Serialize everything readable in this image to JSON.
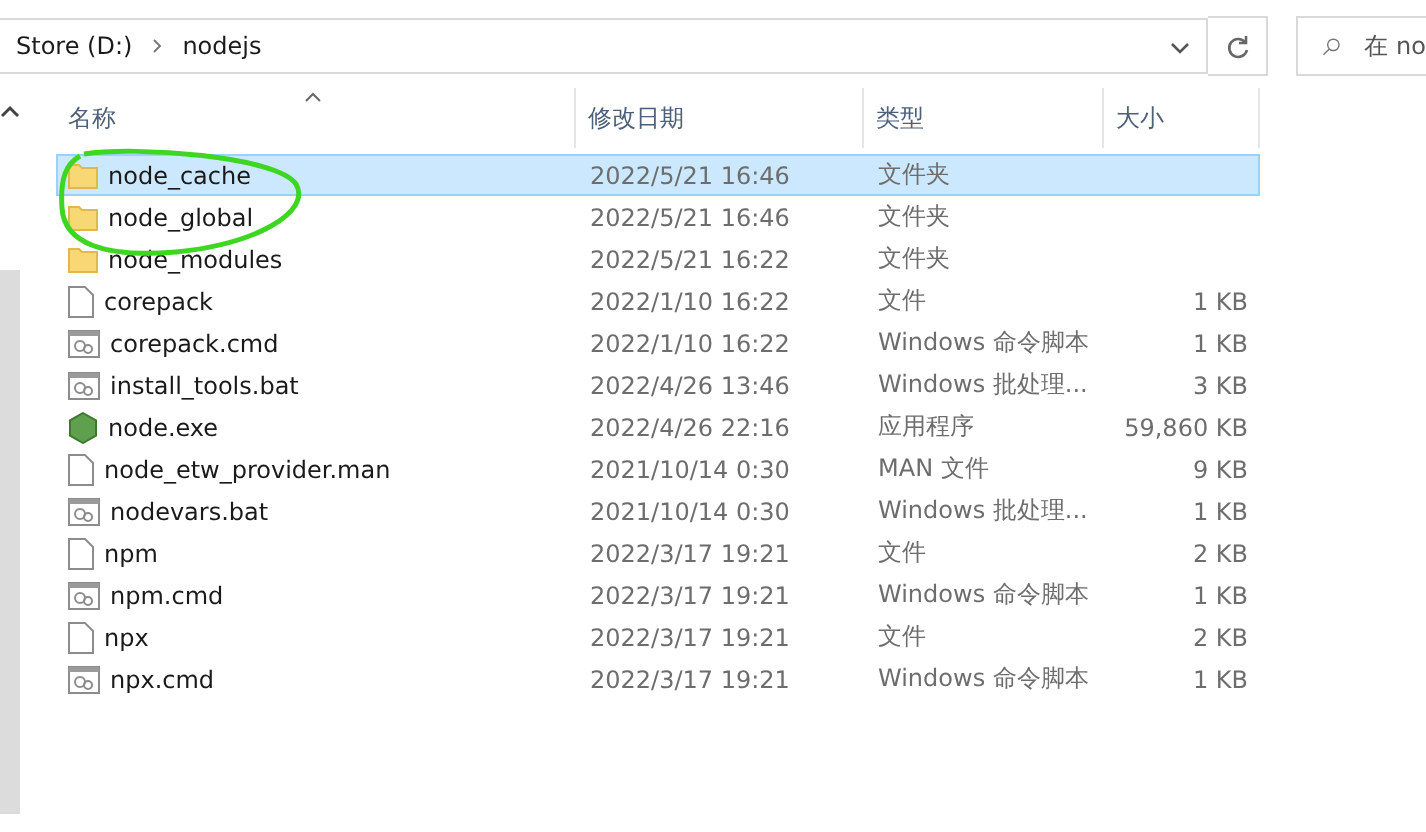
{
  "address_bar": {
    "path": [
      "Store (D:)",
      "nodejs"
    ]
  },
  "search": {
    "placeholder": "在 no"
  },
  "columns": [
    "名称",
    "修改日期",
    "类型",
    "大小"
  ],
  "rows": [
    {
      "kind": "folder",
      "name": "node_cache",
      "date": "2022/5/21 16:46",
      "type": "文件夹",
      "size": "",
      "selected": true
    },
    {
      "kind": "folder",
      "name": "node_global",
      "date": "2022/5/21 16:46",
      "type": "文件夹",
      "size": "",
      "selected": false
    },
    {
      "kind": "folder",
      "name": "node_modules",
      "date": "2022/5/21 16:22",
      "type": "文件夹",
      "size": "",
      "selected": false
    },
    {
      "kind": "file",
      "name": "corepack",
      "date": "2022/1/10 16:22",
      "type": "文件",
      "size": "1 KB",
      "selected": false
    },
    {
      "kind": "script",
      "name": "corepack.cmd",
      "date": "2022/1/10 16:22",
      "type": "Windows 命令脚本",
      "size": "1 KB",
      "selected": false
    },
    {
      "kind": "script",
      "name": "install_tools.bat",
      "date": "2022/4/26 13:46",
      "type": "Windows 批处理...",
      "size": "3 KB",
      "selected": false
    },
    {
      "kind": "exe",
      "name": "node.exe",
      "date": "2022/4/26 22:16",
      "type": "应用程序",
      "size": "59,860 KB",
      "selected": false
    },
    {
      "kind": "file",
      "name": "node_etw_provider.man",
      "date": "2021/10/14 0:30",
      "type": "MAN 文件",
      "size": "9 KB",
      "selected": false
    },
    {
      "kind": "script",
      "name": "nodevars.bat",
      "date": "2021/10/14 0:30",
      "type": "Windows 批处理...",
      "size": "1 KB",
      "selected": false
    },
    {
      "kind": "file",
      "name": "npm",
      "date": "2022/3/17 19:21",
      "type": "文件",
      "size": "2 KB",
      "selected": false
    },
    {
      "kind": "script",
      "name": "npm.cmd",
      "date": "2022/3/17 19:21",
      "type": "Windows 命令脚本",
      "size": "1 KB",
      "selected": false
    },
    {
      "kind": "file",
      "name": "npx",
      "date": "2022/3/17 19:21",
      "type": "文件",
      "size": "2 KB",
      "selected": false
    },
    {
      "kind": "script",
      "name": "npx.cmd",
      "date": "2022/3/17 19:21",
      "type": "Windows 命令脚本",
      "size": "1 KB",
      "selected": false
    }
  ]
}
